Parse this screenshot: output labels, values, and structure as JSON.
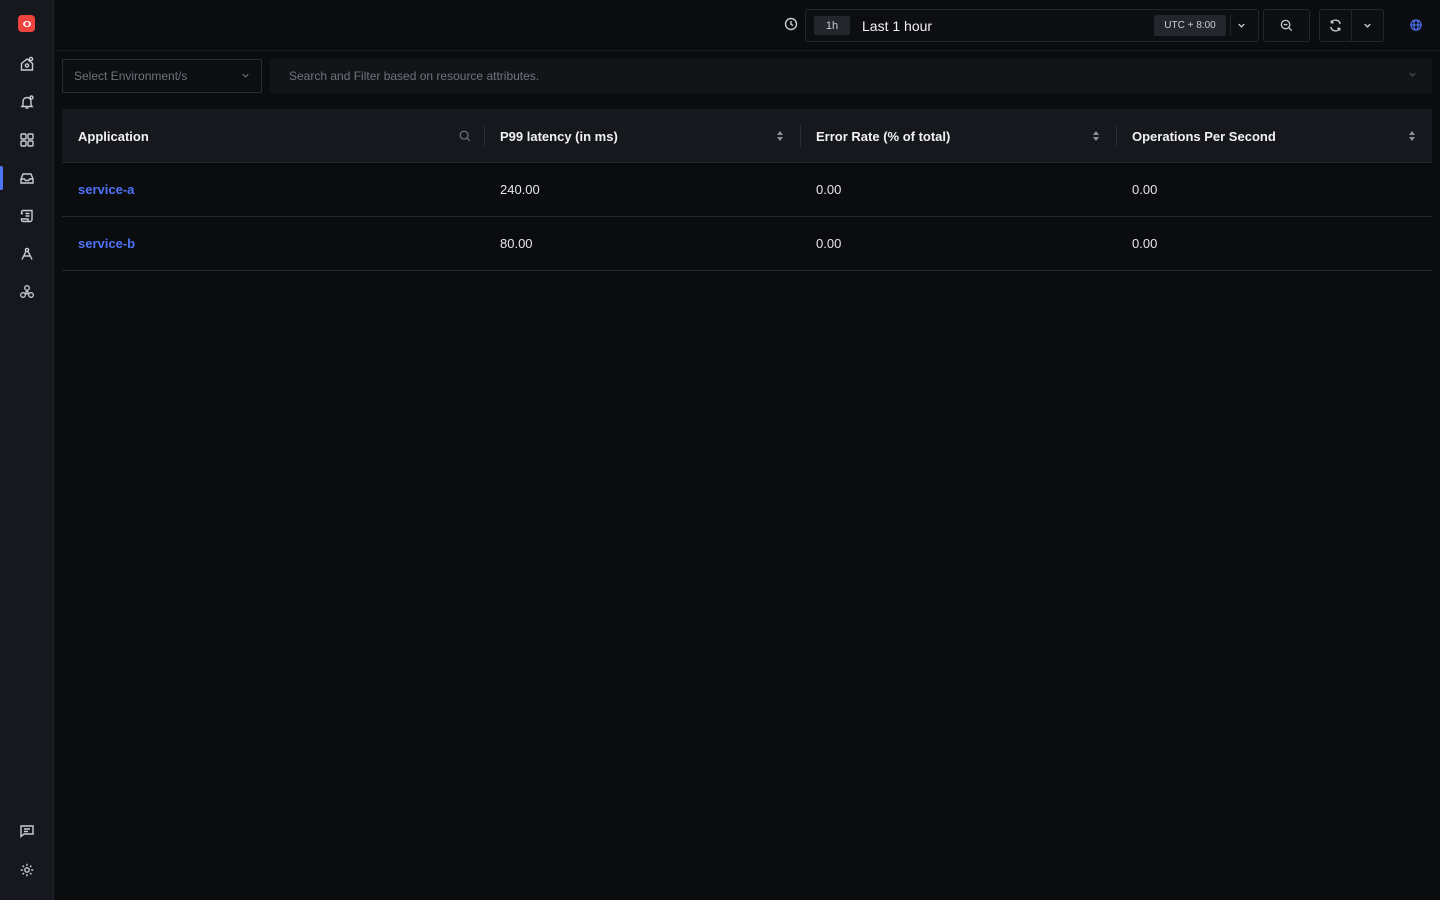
{
  "sidebar": {
    "items": [
      {
        "name": "home",
        "icon": "home-icon"
      },
      {
        "name": "alerts",
        "icon": "bell-icon"
      },
      {
        "name": "dashboards",
        "icon": "grid-icon"
      },
      {
        "name": "services",
        "icon": "inbox-icon",
        "active": true
      },
      {
        "name": "logs",
        "icon": "scroll-icon"
      },
      {
        "name": "traces",
        "icon": "route-icon"
      },
      {
        "name": "integrations",
        "icon": "nodes-icon"
      }
    ],
    "bottom": [
      {
        "name": "feedback",
        "icon": "chat-icon"
      },
      {
        "name": "settings",
        "icon": "gear-icon"
      }
    ]
  },
  "topbar": {
    "time_badge": "1h",
    "time_label": "Last 1 hour",
    "timezone": "UTC + 8:00"
  },
  "filters": {
    "env_placeholder": "Select Environment/s",
    "search_placeholder": "Search and Filter based on resource attributes."
  },
  "table": {
    "headers": {
      "application": "Application",
      "p99": "P99 latency (in ms)",
      "error_rate": "Error Rate (% of total)",
      "ops": "Operations Per Second"
    },
    "rows": [
      {
        "application": "service-a",
        "p99": "240.00",
        "error_rate": "0.00",
        "ops": "0.00"
      },
      {
        "application": "service-b",
        "p99": "80.00",
        "error_rate": "0.00",
        "ops": "0.00"
      }
    ]
  },
  "colors": {
    "accent": "#4e74f8",
    "brand": "#f0433d",
    "background": "#0b0c0e",
    "sidebar": "#16181d"
  }
}
